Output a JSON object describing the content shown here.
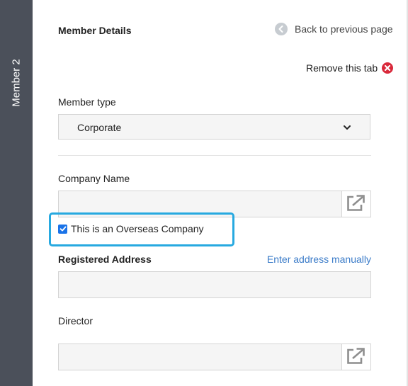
{
  "side_tab": {
    "label": "Member 2"
  },
  "header": {
    "title": "Member Details",
    "back_label": "Back to previous page",
    "remove_label": "Remove this tab"
  },
  "form": {
    "member_type": {
      "label": "Member type",
      "value": "Corporate"
    },
    "company_name": {
      "label": "Company Name",
      "value": ""
    },
    "overseas": {
      "label": "This is an Overseas Company",
      "checked": true
    },
    "registered_address": {
      "label": "Registered Address",
      "manual_link": "Enter address manually",
      "value": ""
    },
    "director": {
      "label": "Director",
      "value": ""
    }
  },
  "icons": {
    "back": "arrow-left-circle-icon",
    "remove": "close-circle-icon",
    "select": "chevron-down-icon",
    "lookup": "external-link-icon",
    "checkbox": "check-icon"
  },
  "colors": {
    "sidebar": "#4b505a",
    "link": "#3a7bc8",
    "remove": "#d9293b",
    "checkbox": "#1a73e8",
    "highlight": "#27a9e0",
    "input_bg": "#f5f5f5"
  }
}
